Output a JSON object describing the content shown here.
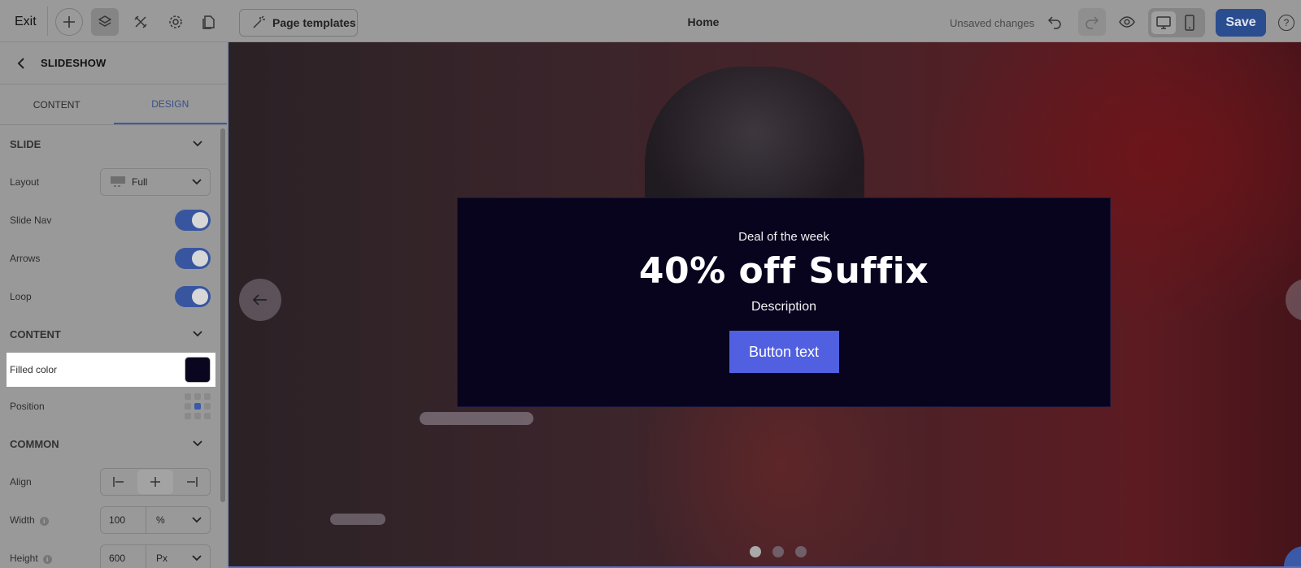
{
  "topbar": {
    "exit_label": "Exit",
    "page_templates_label": "Page templates",
    "page_title": "Home",
    "unsaved_label": "Unsaved changes",
    "save_label": "Save",
    "help_label": "?"
  },
  "panel": {
    "title": "SLIDESHOW",
    "tabs": [
      {
        "label": "CONTENT",
        "active": false
      },
      {
        "label": "DESIGN",
        "active": true
      }
    ],
    "slide_section": "SLIDE",
    "layout_label": "Layout",
    "layout_value": "Full",
    "slide_nav_label": "Slide Nav",
    "arrows_label": "Arrows",
    "loop_label": "Loop",
    "content_section": "CONTENT",
    "filled_color_label": "Filled color",
    "filled_color_value": "#0b0620",
    "position_label": "Position",
    "common_section": "COMMON",
    "align_label": "Align",
    "width_label": "Width",
    "width_value": "100",
    "width_unit": "%",
    "height_label": "Height",
    "height_value": "600",
    "height_unit": "Px"
  },
  "slide": {
    "eyebrow": "Deal of the week",
    "headline": "40% off Suffix",
    "description": "Description",
    "button_label": "Button text",
    "button_color": "#5160e0",
    "background_color": "#08041e",
    "slide_count": 3,
    "active_slide": 1
  }
}
